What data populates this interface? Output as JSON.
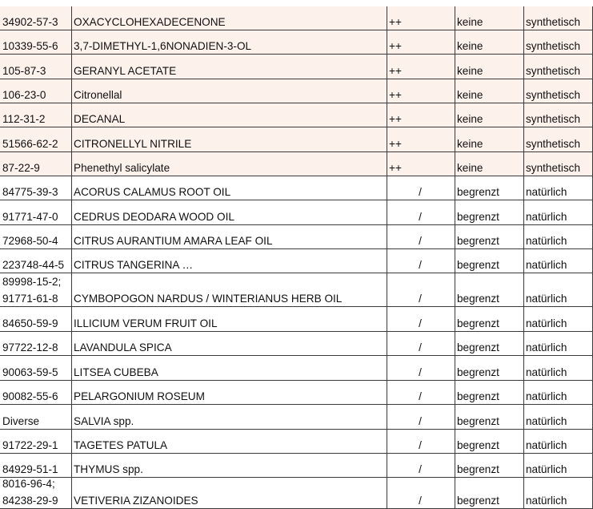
{
  "rows": [
    {
      "cas": "34902-57-3",
      "name": "OXACYCLOHEXADECENONE",
      "symbol": "++",
      "limit": "keine",
      "origin": "synthetisch",
      "highlight": true
    },
    {
      "cas": "10339-55-6",
      "name": "3,7-DIMETHYL-1,6NONADIEN-3-OL",
      "symbol": "++",
      "limit": "keine",
      "origin": "synthetisch",
      "highlight": true
    },
    {
      "cas": "105-87-3",
      "name": "GERANYL ACETATE",
      "symbol": "++",
      "limit": "keine",
      "origin": "synthetisch",
      "highlight": true
    },
    {
      "cas": "106-23-0",
      "name": "Citronellal",
      "symbol": "++",
      "limit": "keine",
      "origin": "synthetisch",
      "highlight": true
    },
    {
      "cas": "112-31-2",
      "name": "DECANAL",
      "symbol": "++",
      "limit": "keine",
      "origin": "synthetisch",
      "highlight": true
    },
    {
      "cas": "51566-62-2",
      "name": "CITRONELLYL NITRILE",
      "symbol": "++",
      "limit": "keine",
      "origin": "synthetisch",
      "highlight": true
    },
    {
      "cas": "87-22-9",
      "name": "Phenethyl salicylate",
      "symbol": "++",
      "limit": "keine",
      "origin": "synthetisch",
      "highlight": true
    },
    {
      "cas": "84775-39-3",
      "name": "ACORUS CALAMUS ROOT OIL",
      "symbol": "/",
      "limit": "begrenzt",
      "origin": "natürlich",
      "highlight": false
    },
    {
      "cas": "91771-47-0",
      "name": "CEDRUS DEODARA WOOD OIL",
      "symbol": "/",
      "limit": "begrenzt",
      "origin": "natürlich",
      "highlight": false
    },
    {
      "cas": "72968-50-4",
      "name": "CITRUS AURANTIUM AMARA LEAF OIL",
      "symbol": "/",
      "limit": "begrenzt",
      "origin": "natürlich",
      "highlight": false
    },
    {
      "cas": "223748-44-5",
      "name": "CITRUS TANGERINA …",
      "symbol": "/",
      "limit": "begrenzt",
      "origin": "natürlich",
      "highlight": false
    },
    {
      "cas": "89998-15-2;",
      "cas2": "91771-61-8",
      "name": "CYMBOPOGON NARDUS / WINTERIANUS HERB OIL",
      "symbol": "/",
      "limit": "begrenzt",
      "origin": "natürlich",
      "highlight": false
    },
    {
      "cas": "84650-59-9",
      "name": "ILLICIUM VERUM FRUIT OIL",
      "symbol": "/",
      "limit": "begrenzt",
      "origin": "natürlich",
      "highlight": false
    },
    {
      "cas": "97722-12-8",
      "name": "LAVANDULA SPICA",
      "symbol": "/",
      "limit": "begrenzt",
      "origin": "natürlich",
      "highlight": false
    },
    {
      "cas": "90063-59-5",
      "name": "LITSEA CUBEBA",
      "symbol": "/",
      "limit": "begrenzt",
      "origin": "natürlich",
      "highlight": false
    },
    {
      "cas": "90082-55-6",
      "name": "PELARGONIUM ROSEUM",
      "symbol": "/",
      "limit": "begrenzt",
      "origin": "natürlich",
      "highlight": false
    },
    {
      "cas": "Diverse",
      "name": "SALVIA spp.",
      "symbol": "/",
      "limit": "begrenzt",
      "origin": "natürlich",
      "highlight": false
    },
    {
      "cas": "91722-29-1",
      "name": "TAGETES PATULA",
      "symbol": "/",
      "limit": "begrenzt",
      "origin": "natürlich",
      "highlight": false
    },
    {
      "cas": "84929-51-1",
      "name": "THYMUS spp.",
      "symbol": "/",
      "limit": "begrenzt",
      "origin": "natürlich",
      "highlight": false
    },
    {
      "cas": "8016-96-4;",
      "cas2": "84238-29-9",
      "name": "VETIVERIA ZIZANOIDES",
      "symbol": "/",
      "limit": "begrenzt",
      "origin": "natürlich",
      "highlight": false
    }
  ]
}
